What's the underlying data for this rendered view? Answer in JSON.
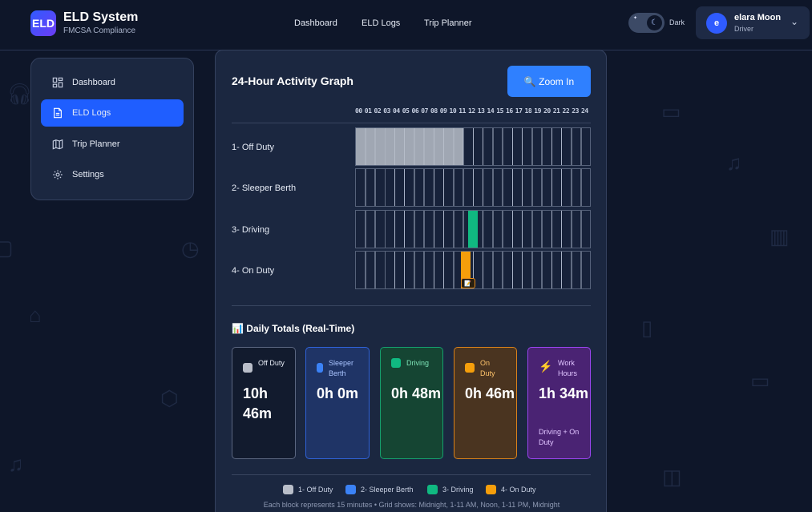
{
  "brand": {
    "logo": "ELD",
    "title": "ELD System",
    "subtitle": "FMCSA Compliance"
  },
  "topnav": [
    {
      "label": "Dashboard"
    },
    {
      "label": "ELD Logs"
    },
    {
      "label": "Trip Planner"
    }
  ],
  "theme": {
    "label": "Dark",
    "icon": "moon-icon"
  },
  "user": {
    "initial": "e",
    "name": "elara Moon",
    "role": "Driver"
  },
  "sidebar": {
    "items": [
      {
        "label": "Dashboard",
        "icon": "dashboard-icon",
        "active": false
      },
      {
        "label": "ELD Logs",
        "icon": "document-icon",
        "active": true
      },
      {
        "label": "Trip Planner",
        "icon": "map-icon",
        "active": false
      },
      {
        "label": "Settings",
        "icon": "gear-icon",
        "active": false
      }
    ]
  },
  "graph": {
    "title": "24-Hour Activity Graph",
    "zoom_label": "🔍 Zoom In",
    "hours": [
      "00",
      "01",
      "02",
      "03",
      "04",
      "05",
      "06",
      "07",
      "08",
      "09",
      "10",
      "11",
      "12",
      "13",
      "14",
      "15",
      "16",
      "17",
      "18",
      "19",
      "20",
      "21",
      "22",
      "23",
      "24"
    ],
    "rows": [
      {
        "label": "1- Off Duty",
        "color": "#b9bec9",
        "segments": [
          {
            "start": 0,
            "end": 11
          }
        ]
      },
      {
        "label": "2- Sleeper Berth",
        "color": "#3b82f6",
        "segments": []
      },
      {
        "label": "3- Driving",
        "color": "#10b981",
        "segments": [
          {
            "start": 11.5,
            "end": 12.5
          }
        ]
      },
      {
        "label": "4- On Duty",
        "color": "#f59e0b",
        "segments": [
          {
            "start": 10.75,
            "end": 11.75
          }
        ]
      }
    ],
    "marker_icon": "📝"
  },
  "totals": {
    "title": "📊 Daily Totals (Real-Time)",
    "cards": [
      {
        "label": "Off Duty",
        "value": "10h 46m",
        "swatch": "#b9bec9",
        "bg": "#121b2e",
        "border": "#5b6680",
        "labelColor": "#e6ebf5"
      },
      {
        "label": "Sleeper Berth",
        "value": "0h 0m",
        "swatch": "#3b82f6",
        "bg": "#1f3466",
        "border": "#2f62d8",
        "labelColor": "#a9c4ff"
      },
      {
        "label": "Driving",
        "value": "0h 48m",
        "swatch": "#10b981",
        "bg": "#154533",
        "border": "#15a06e",
        "labelColor": "#7ee4b8"
      },
      {
        "label": "On Duty",
        "value": "0h 46m",
        "swatch": "#f59e0b",
        "bg": "#4a3420",
        "border": "#d9821b",
        "labelColor": "#ffc46b"
      },
      {
        "label": "Work Hours",
        "value": "1h 34m",
        "icon": "⚡",
        "note": "Driving + On Duty",
        "bg": "#4a2373",
        "border": "#9b45f0",
        "labelColor": "#e0c4ff"
      }
    ]
  },
  "legend": [
    {
      "label": "1- Off Duty",
      "color": "#b9bec9"
    },
    {
      "label": "2- Sleeper Berth",
      "color": "#3b82f6"
    },
    {
      "label": "3- Driving",
      "color": "#10b981"
    },
    {
      "label": "4- On Duty",
      "color": "#f59e0b"
    }
  ],
  "footnote": "Each block represents 15 minutes • Grid shows: Midnight, 1-11 AM, Noon, 1-11 PM, Midnight"
}
